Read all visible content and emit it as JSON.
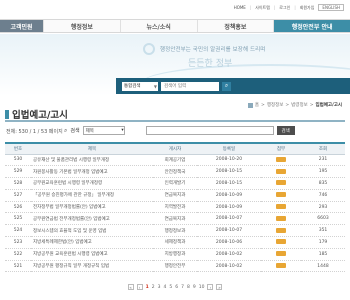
{
  "util": {
    "links": [
      "HOME",
      "사이트맵",
      "로그인",
      "회원가입"
    ],
    "lang": "ENGLISH"
  },
  "nav": {
    "tabs": [
      "고객민원",
      "행정정보",
      "뉴스/소식",
      "정책홍보",
      "행정안전부 안내"
    ]
  },
  "banner": {
    "slogan1": "행정안전부는 국민의 알권리를 보장해 드리며",
    "slogan2": "든든한 정부"
  },
  "search": {
    "select": "통합검색",
    "placeholder": "검색어 입력",
    "button": "검색"
  },
  "breadcrumb": {
    "items": [
      "홈",
      "행정정보",
      "법령정보"
    ],
    "current": "입법예고/고시"
  },
  "page_title": "입법예고/고시",
  "count_text": "전체: 530 / 1 / 53 페이지",
  "filter": {
    "label": "검색",
    "select": "제목",
    "button": "검색"
  },
  "table": {
    "headers": [
      "번호",
      "제목",
      "게시자",
      "등록일",
      "첨부",
      "조회"
    ],
    "rows": [
      {
        "no": "530",
        "title": "공유재산 및 물품관리법 시행령 일부개정",
        "author": "회계공기업",
        "date": "2008-10-20",
        "views": "231"
      },
      {
        "no": "529",
        "title": "자원봉사활동 기본법 일부개정 입법예고",
        "author": "안전정책국",
        "date": "2008-10-15",
        "views": "195"
      },
      {
        "no": "528",
        "title": "공무원교육훈련법 시행령 일부개정령",
        "author": "인력개발기",
        "date": "2008-10-15",
        "views": "835"
      },
      {
        "no": "527",
        "title": "「공무원 승진평가에 관한 규정」 일부개정",
        "author": "연금복지과",
        "date": "2008-10-09",
        "views": "746"
      },
      {
        "no": "526",
        "title": "전자정부법 일부개정법률(안) 입법예고",
        "author": "지역발전과",
        "date": "2008-10-09",
        "views": "293"
      },
      {
        "no": "525",
        "title": "공무원연금법 전부개정법률(안) 입법예고",
        "author": "연금복지과",
        "date": "2008-10-07",
        "views": "6603"
      },
      {
        "no": "524",
        "title": "정보시스템의 효율적 도입 및 운영 입법",
        "author": "행정정보과",
        "date": "2008-10-07",
        "views": "351"
      },
      {
        "no": "523",
        "title": "지방세특례제한법(안) 입법예고",
        "author": "세제정책과",
        "date": "2008-10-06",
        "views": "179"
      },
      {
        "no": "522",
        "title": "지방공무원 교육훈련법 시행령 입법예고",
        "author": "지방행정과",
        "date": "2008-10-02",
        "views": "185"
      },
      {
        "no": "521",
        "title": "지방공무원 평정규칙 일부 개정규칙 입법",
        "author": "행정안전부",
        "date": "2008-10-02",
        "views": "1448"
      }
    ]
  },
  "pager": {
    "pages": [
      "1",
      "2",
      "3",
      "4",
      "5",
      "6",
      "7",
      "8",
      "9",
      "10"
    ],
    "current": "1"
  },
  "colors": {
    "nav_first": "#6d7f8e",
    "nav_last": "#3d8ea7",
    "search_bar": "#1d5f7b",
    "accent": "#3d8ea7",
    "badge": "#e8a634",
    "current_page": "#d0301b"
  }
}
